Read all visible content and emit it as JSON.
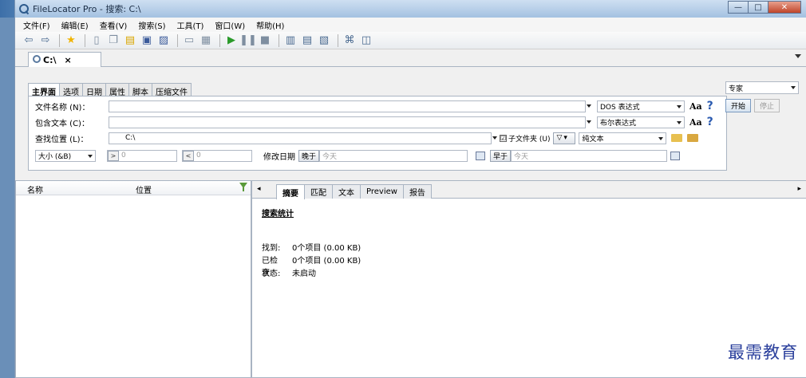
{
  "window": {
    "title": "FileLocator Pro - 搜索: C:\\"
  },
  "menu": [
    "文件(F)",
    "编辑(E)",
    "查看(V)",
    "搜索(S)",
    "工具(T)",
    "窗口(W)",
    "帮助(H)"
  ],
  "search_tab": {
    "label": "C:\\",
    "close": "×"
  },
  "criteria": {
    "tabs": [
      "主界面",
      "选项",
      "日期",
      "属性",
      "脚本",
      "压缩文件"
    ],
    "file_name_label": "文件名称 (N)：",
    "file_name_mode": "DOS 表达式",
    "contains_label": "包含文本 (C)：",
    "contains_mode": "布尔表达式",
    "look_in_label": "查找位置 (L)：",
    "look_in_value": "C:\\",
    "subfolders_label": "子文件夹 (U)",
    "subfolders_check": "☑",
    "look_in_type": "纯文本",
    "size_label": "大小 (&B)",
    "size_min": "0",
    "size_max": "0",
    "size_min_op": ">",
    "size_max_op": "<",
    "modified_label": "修改日期",
    "date_op": "晚于",
    "date_from": "今天",
    "date_op2": "早于",
    "date_to": "今天",
    "case_label": "Aa",
    "help_label": "?"
  },
  "right_panel": {
    "profile": "专家",
    "start": "开始",
    "stop": "停止"
  },
  "results": {
    "columns": [
      "名称",
      "位置"
    ]
  },
  "preview": {
    "tabs": [
      "摘要",
      "匹配",
      "文本",
      "Preview",
      "报告"
    ],
    "left_nav": "◂",
    "right_nav": "▸",
    "heading": "搜索统计",
    "found_key": "找到:",
    "found_val": "0个项目 (0.00 KB)",
    "checked_key": "已检查:",
    "checked_val": "0个项目 (0.00 KB)",
    "status_key": "状态:",
    "status_val": "未启动"
  },
  "watermark": "最需教育"
}
